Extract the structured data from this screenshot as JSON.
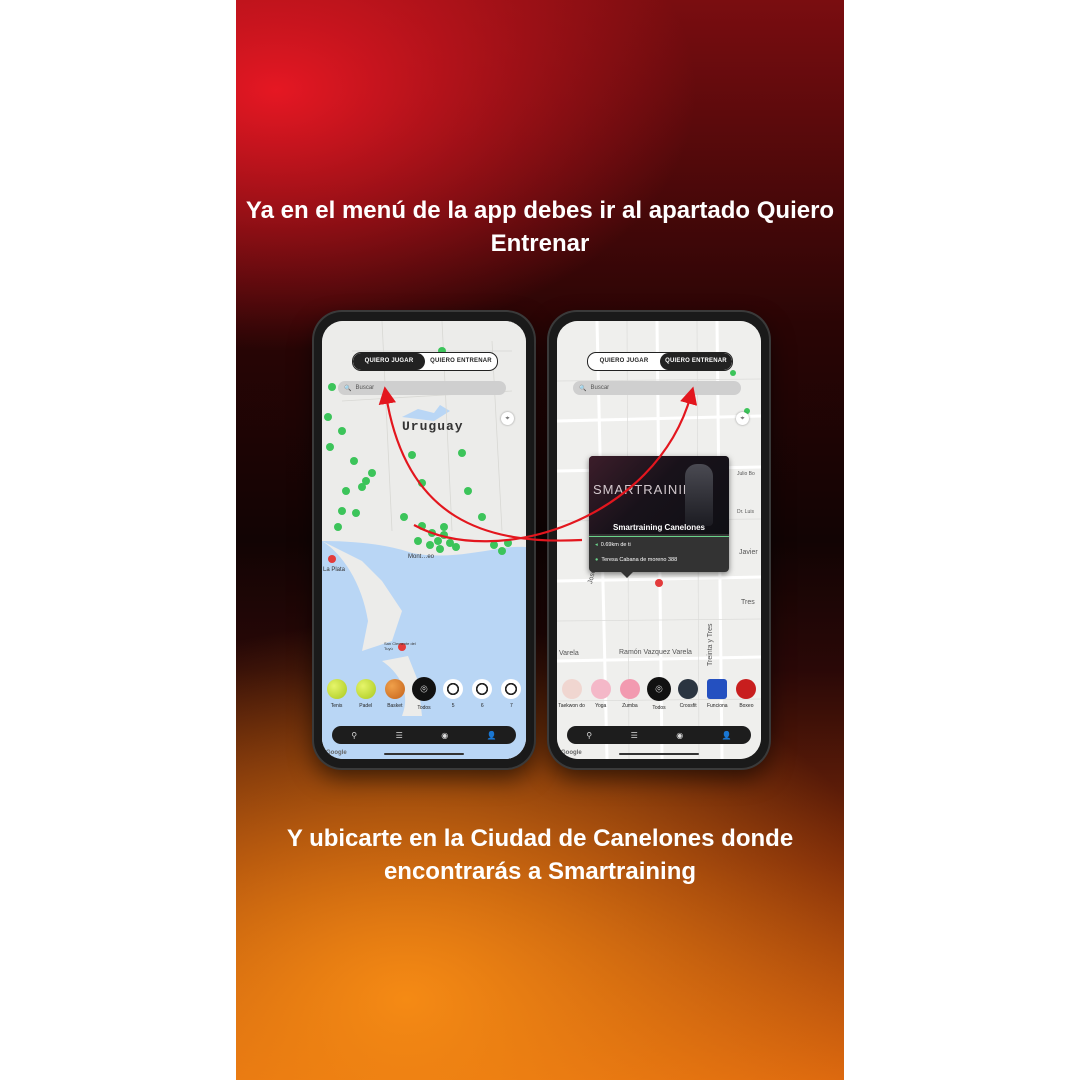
{
  "headline_top": "Ya en el menú de la app debes ir al apartado Quiero Entrenar",
  "headline_bottom": "Y ubicarte en la Ciudad de Canelones donde encontrarás a Smartraining",
  "colors": {
    "accent_red": "#e3161e",
    "pin_green": "#3cc45a",
    "pin_red": "#e33b3b",
    "dark": "#1d1d1d"
  },
  "left_phone": {
    "tabs": [
      "QUIERO JUGAR",
      "QUIERO ENTRENAR"
    ],
    "active_tab": "QUIERO JUGAR",
    "search_placeholder": "Buscar",
    "map_country": "Uruguay",
    "city_labels": {
      "la_plata": "La Plata",
      "montevideo": "Mont…eo",
      "san_clemente": "San Clemente del Tuyú"
    },
    "sports": [
      {
        "label": "Tenis",
        "icon": "tennis-ball-icon"
      },
      {
        "label": "Padel",
        "icon": "padel-ball-icon"
      },
      {
        "label": "Basket",
        "icon": "basketball-icon"
      },
      {
        "label": "Todos",
        "icon": "all-pin-icon"
      },
      {
        "label": "5",
        "icon": "soccer-ball-icon"
      },
      {
        "label": "6",
        "icon": "soccer-ball-icon"
      },
      {
        "label": "7",
        "icon": "soccer-ball-icon"
      }
    ],
    "nav_icons": [
      "map-pin-icon",
      "list-icon",
      "pin-circle-icon",
      "user-icon"
    ],
    "google": "Google"
  },
  "right_phone": {
    "tabs": [
      "QUIERO JUGAR",
      "QUIERO ENTRENAR"
    ],
    "active_tab": "QUIERO ENTRENAR",
    "search_placeholder": "Buscar",
    "popup": {
      "image_text": "SMARTRAINING",
      "title": "Smartraining Canelones",
      "distance": "0.69km de ti",
      "address": "Teresa Cabana de moreno 388"
    },
    "streets": {
      "batlle": "José Batlle y Ordóñez",
      "ramon": "Ramón Vazquez Varela",
      "varela": "Varela",
      "treinta": "Treinta y Tres",
      "tres": "Tres",
      "javier": "Javier",
      "dr_luis": "Dr. Luis",
      "julio": "Julio Bo"
    },
    "sports": [
      {
        "label": "Taekwon do",
        "icon": "taekwondo-icon"
      },
      {
        "label": "Yoga",
        "icon": "yoga-icon"
      },
      {
        "label": "Zumba",
        "icon": "zumba-icon"
      },
      {
        "label": "Todos",
        "icon": "all-pin-icon"
      },
      {
        "label": "Crossfit",
        "icon": "kettlebell-icon"
      },
      {
        "label": "Funciona",
        "icon": "cone-icon"
      },
      {
        "label": "Boxeo",
        "icon": "boxing-glove-icon"
      }
    ],
    "nav_icons": [
      "map-pin-icon",
      "list-icon",
      "pin-circle-icon",
      "user-icon"
    ],
    "google": "Google"
  }
}
